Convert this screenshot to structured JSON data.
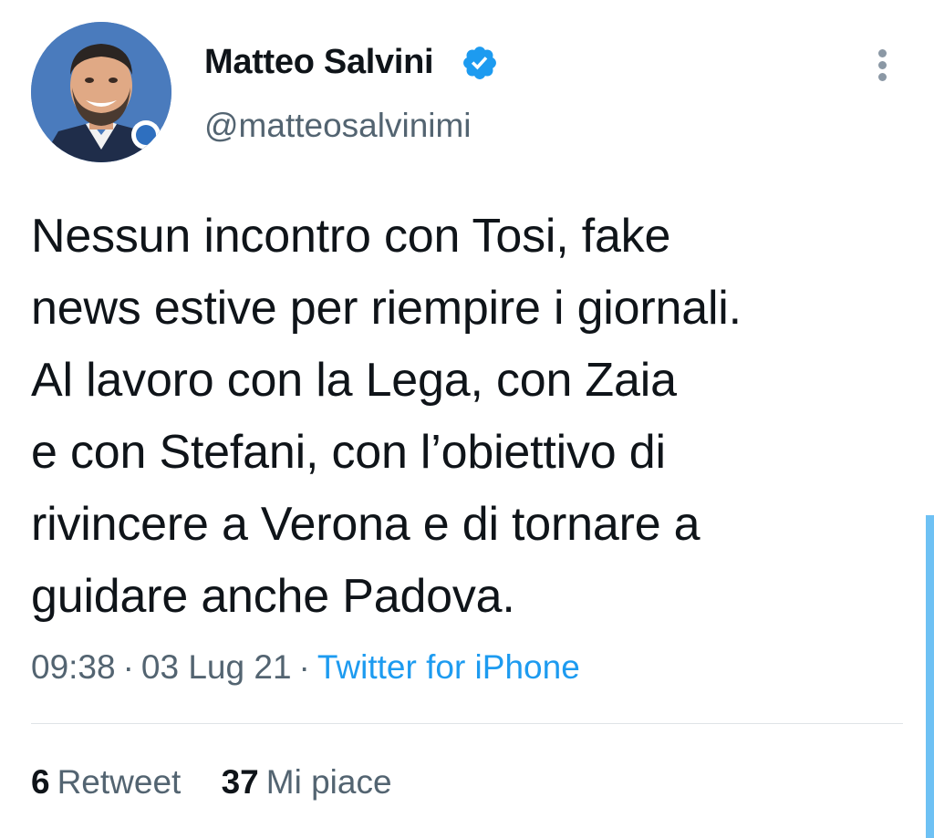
{
  "user": {
    "display_name": "Matteo Salvini",
    "handle": "@matteosalvinimi",
    "verified_icon": "verified-badge-icon",
    "avatar_icon": "avatar"
  },
  "tweet": {
    "text": "Nessun incontro con Tosi, fake\nnews estive per riempire i giornali.\nAl lavoro con la Lega, con Zaia\ne con Stefani, con l’obiettivo di\nrivincere a Verona e di tornare a\nguidare anche Padova.",
    "time": "09:38",
    "date": "03 Lug 21",
    "separator": "·",
    "source": "Twitter for iPhone"
  },
  "stats": {
    "retweets_count": "6",
    "retweets_label": "Retweet",
    "likes_count": "37",
    "likes_label": "Mi piace"
  },
  "colors": {
    "accent": "#1d9bf0",
    "secondary_text": "#536471",
    "primary_text": "#0f1419",
    "scrollbar": "#6ec1f4"
  },
  "icons": {
    "more": "more-vertical-icon"
  }
}
